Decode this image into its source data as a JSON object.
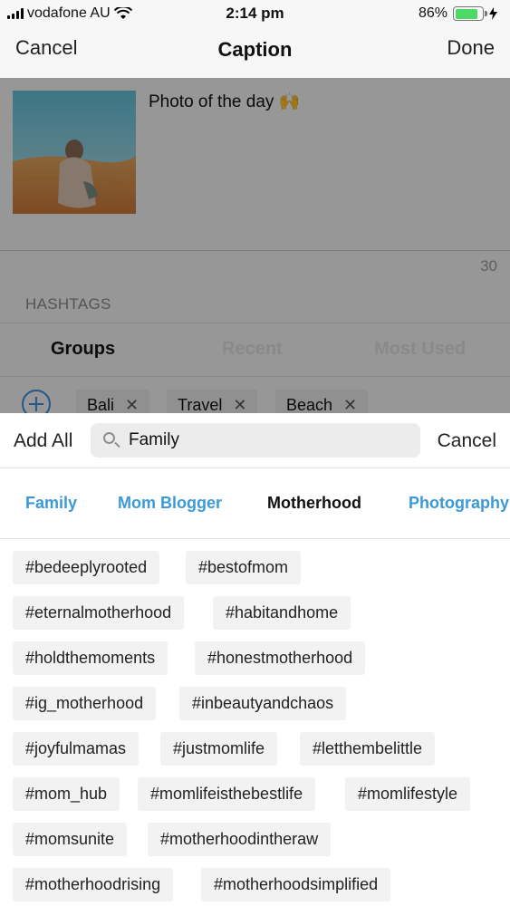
{
  "status_bar": {
    "carrier": "vodafone AU",
    "time": "2:14 pm",
    "battery": "86%",
    "battery_level": 0.86
  },
  "nav": {
    "cancel": "Cancel",
    "title": "Caption",
    "done": "Done"
  },
  "post": {
    "caption": "Photo of the day 🙌",
    "char_count": "30"
  },
  "hashtags": {
    "label": "HASHTAGS",
    "segments": [
      "Groups",
      "Recent",
      "Most Used"
    ],
    "selected_groups": [
      "Bali",
      "Travel",
      "Beach"
    ]
  },
  "search": {
    "add_all": "Add All",
    "value": "Family",
    "cancel": "Cancel"
  },
  "categories": [
    "Family",
    "Mom Blogger",
    "Motherhood",
    "Photography"
  ],
  "active_category": "Motherhood",
  "tags": [
    "#bedeeplyrooted",
    "#bestofmom",
    "#eternalmotherhood",
    "#habitandhome",
    "#holdthemoments",
    "#honestmotherhood",
    "#ig_motherhood",
    "#inbeautyandchaos",
    "#joyfulmamas",
    "#justmomlife",
    "#letthembelittle",
    "#mom_hub",
    "#momlifeisthebestlife",
    "#momlifestyle",
    "#momsunite",
    "#motherhoodintheraw",
    "#motherhoodrising",
    "#motherhoodsimplified"
  ],
  "colors": {
    "accent": "#3b99d8",
    "battery": "#4cd964",
    "chip": "#e9e9e9",
    "tag": "#f2f2f2"
  }
}
